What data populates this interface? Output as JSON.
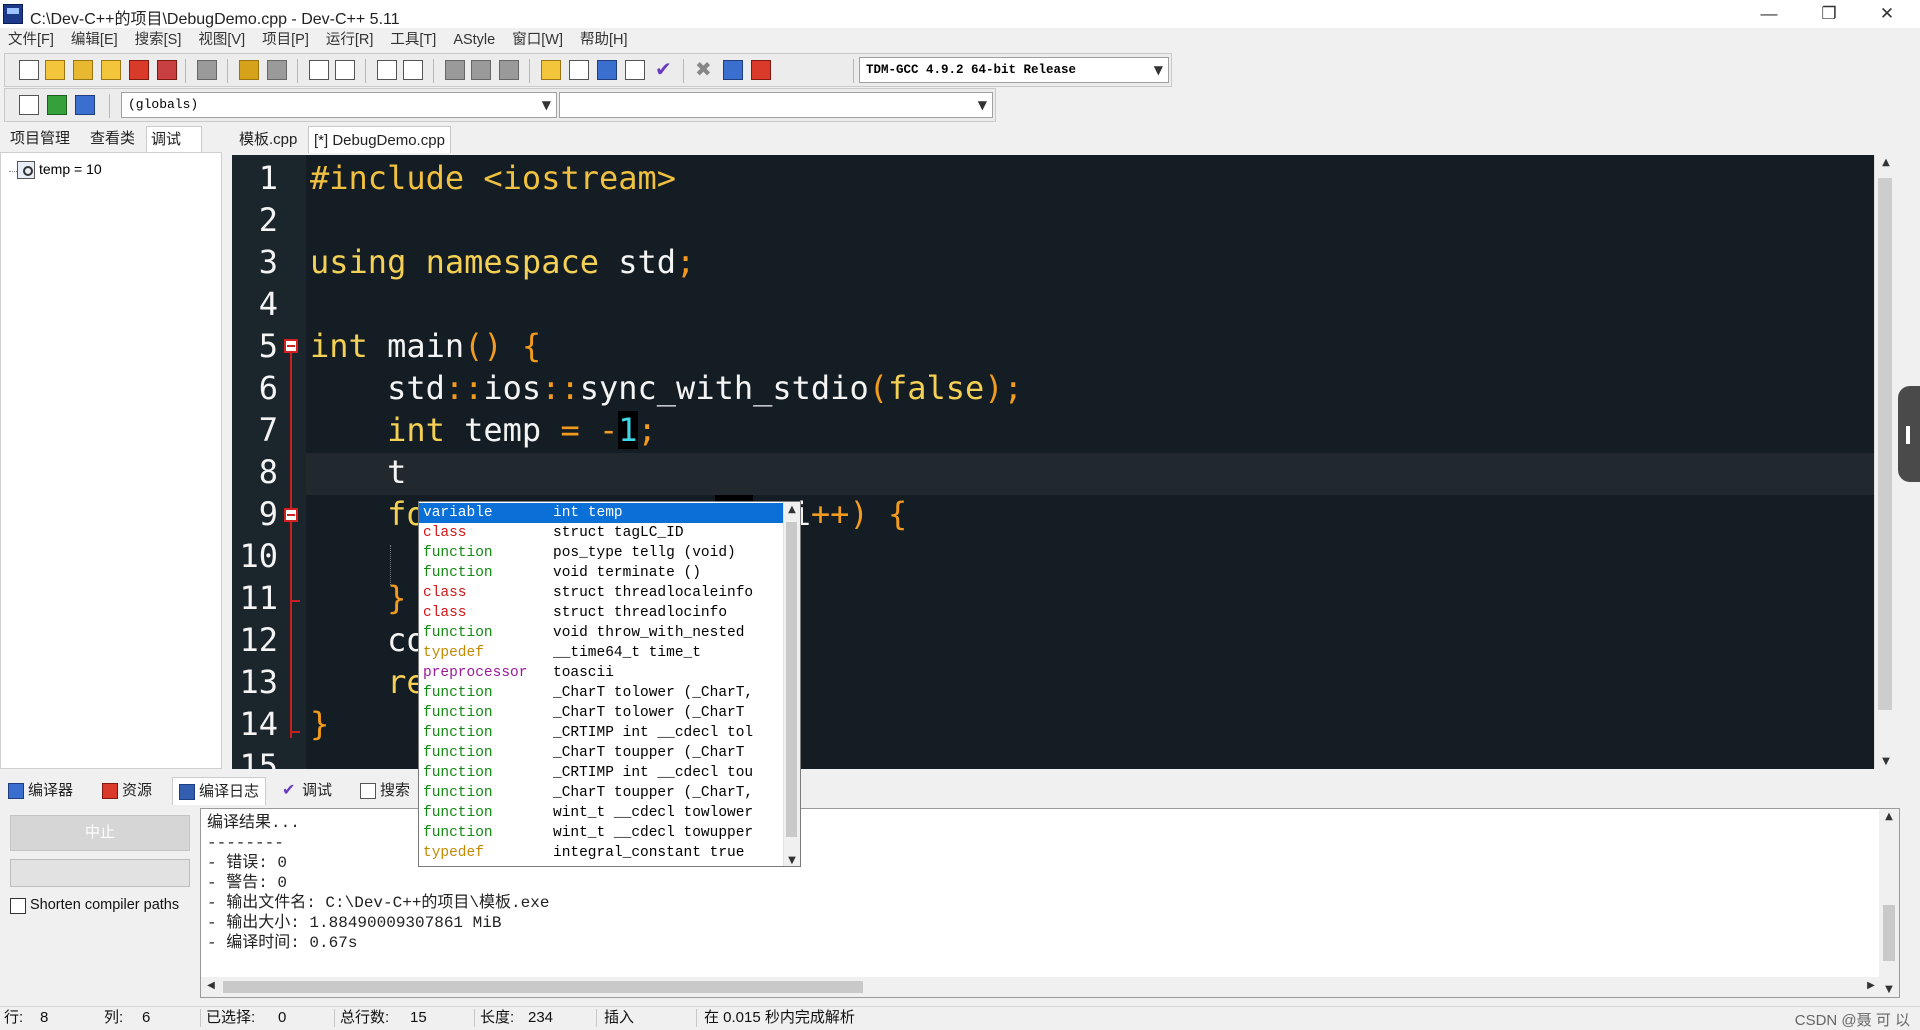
{
  "window": {
    "title": "C:\\Dev-C++的项目\\DebugDemo.cpp - Dev-C++ 5.11",
    "app_icon_label": "DEV",
    "minimize": "—",
    "restore": "❐",
    "close": "✕"
  },
  "menu": [
    "文件[F]",
    "编辑[E]",
    "搜索[S]",
    "视图[V]",
    "项目[P]",
    "运行[R]",
    "工具[T]",
    "AStyle",
    "窗口[W]",
    "帮助[H]"
  ],
  "toolbar": {
    "compiler_select": "TDM-GCC 4.9.2 64-bit Release",
    "scope_select": "(globals)",
    "member_select": ""
  },
  "left_panel": {
    "tabs": [
      "项目管理",
      "查看类",
      "调试"
    ],
    "active_tab": "调试",
    "watch_items": [
      {
        "expression": "temp = 10"
      }
    ]
  },
  "editor": {
    "tabs": [
      "模板.cpp",
      "[*] DebugDemo.cpp"
    ],
    "active_tab": "[*] DebugDemo.cpp",
    "line_numbers": [
      "1",
      "2",
      "3",
      "4",
      "5",
      "6",
      "7",
      "8",
      "9",
      "10",
      "11",
      "12",
      "13",
      "14",
      "15"
    ],
    "cursor": {
      "line": 8,
      "column": 6
    }
  },
  "autocomplete": {
    "items": [
      {
        "kind": "variable",
        "signature": "int temp"
      },
      {
        "kind": "class",
        "signature": "struct tagLC_ID"
      },
      {
        "kind": "function",
        "signature": "pos_type tellg (void)"
      },
      {
        "kind": "function",
        "signature": "void terminate ()"
      },
      {
        "kind": "class",
        "signature": "struct threadlocaleinfo"
      },
      {
        "kind": "class",
        "signature": "struct threadlocinfo"
      },
      {
        "kind": "function",
        "signature": "void throw_with_nested"
      },
      {
        "kind": "typedef",
        "signature": "__time64_t time_t"
      },
      {
        "kind": "preprocessor",
        "signature": "toascii"
      },
      {
        "kind": "function",
        "signature": "_CharT tolower (_CharT,"
      },
      {
        "kind": "function",
        "signature": "_CharT tolower (_CharT"
      },
      {
        "kind": "function",
        "signature": "_CRTIMP int __cdecl tol"
      },
      {
        "kind": "function",
        "signature": "_CharT toupper (_CharT"
      },
      {
        "kind": "function",
        "signature": "_CRTIMP int __cdecl tou"
      },
      {
        "kind": "function",
        "signature": "_CharT toupper (_CharT,"
      },
      {
        "kind": "function",
        "signature": "wint_t __cdecl towlower"
      },
      {
        "kind": "function",
        "signature": "wint_t __cdecl towupper"
      },
      {
        "kind": "typedef",
        "signature": "integral_constant true"
      }
    ],
    "selected_index": 0
  },
  "bottom": {
    "tabs": [
      "编译器",
      "资源",
      "编译日志",
      "调试",
      "搜索"
    ],
    "active_tab": "编译日志",
    "abort_button": "中止",
    "shorten_checkbox_label": "Shorten compiler paths",
    "shorten_checked": false,
    "log_lines": [
      "编译结果...",
      "--------",
      "- 错误: 0",
      "- 警告: 0",
      "- 输出文件名: C:\\Dev-C++的项目\\模板.exe",
      "- 输出大小: 1.88490009307861 MiB",
      "- 编译时间: 0.67s"
    ]
  },
  "status": {
    "row_label": "行:",
    "row_value": "8",
    "col_label": "列:",
    "col_value": "6",
    "selected_label": "已选择:",
    "selected_value": "0",
    "total_lines_label": "总行数:",
    "total_lines_value": "15",
    "length_label": "长度:",
    "length_value": "234",
    "mode": "插入",
    "parse_message": "在 0.015 秒内完成解析",
    "watermark": "CSDN @聂 可 以"
  },
  "colors": {
    "editor_bg": "#141d23",
    "keyword": "#f4d054",
    "operator": "#f29b1f",
    "number": "#40d8e8",
    "selection": "#0a6fd6"
  }
}
